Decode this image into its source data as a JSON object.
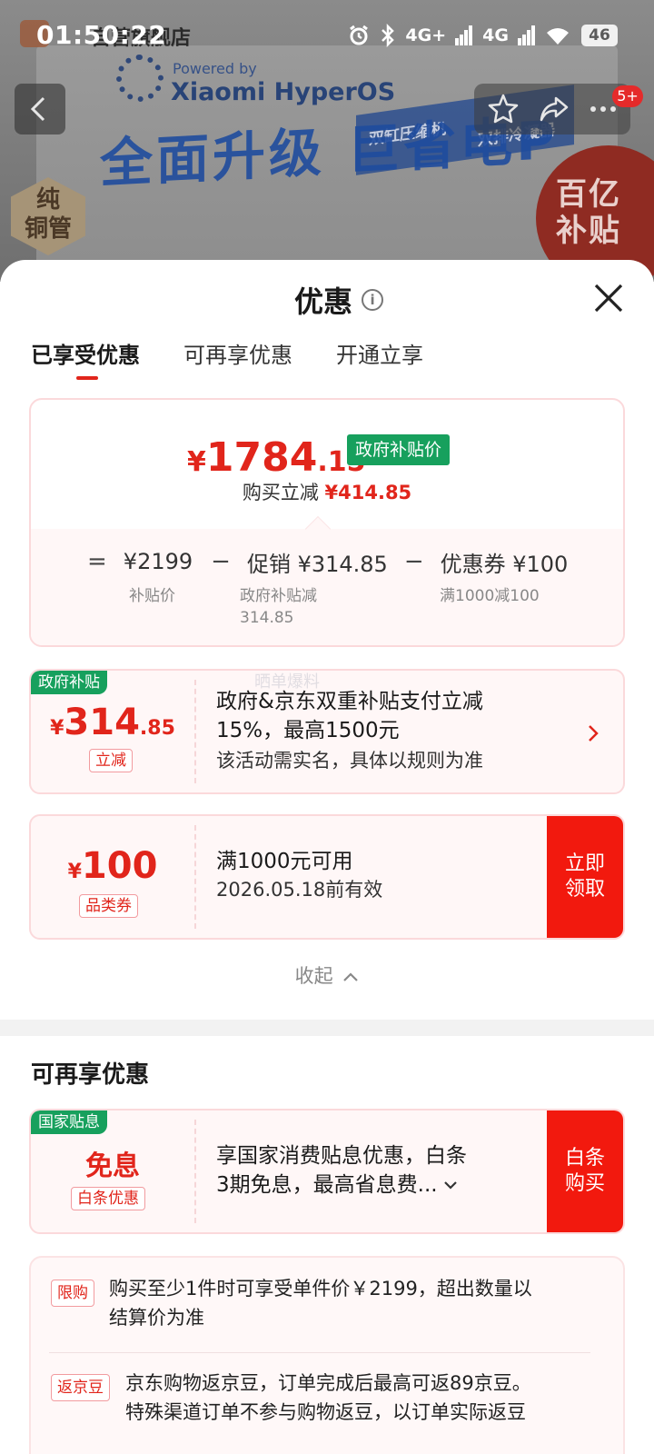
{
  "status_bar": {
    "time": "01:50:22",
    "network_left": "4G+",
    "network_right": "4G",
    "battery": "46"
  },
  "background_page": {
    "store_name": "自营旗舰店",
    "banner_powered": "Powered by",
    "banner_brand": "Xiaomi HyperOS",
    "banner_tag_1": "双缸压缩机",
    "banner_tag_2": "双排冷凝器",
    "banner_headline": "全面升级 巨省电P",
    "badge_line_1": "纯",
    "badge_line_2": "铜管",
    "subsidy_badge_1": "百亿",
    "subsidy_badge_2": "补贴",
    "cart_badge": "5+"
  },
  "sheet": {
    "title": "优惠",
    "tabs": [
      {
        "label": "已享受优惠",
        "active": true
      },
      {
        "label": "可再享优惠",
        "active": false
      },
      {
        "label": "开通立享",
        "active": false
      }
    ],
    "price_card": {
      "currency": "¥",
      "price_int": "1784",
      "price_dec": ".15",
      "price_tag": "政府补贴价",
      "reduce_label": "购买立减",
      "reduce_amount": "¥414.85",
      "calc": {
        "eq": "=",
        "base": "¥2199",
        "base_sub": "补贴价",
        "minus": "−",
        "promo": "促销 ¥314.85",
        "promo_sub_1": "政府补贴减",
        "promo_sub_2": "314.85",
        "coupon": "优惠券 ¥100",
        "coupon_sub": "满1000减100"
      }
    },
    "gov_subsidy": {
      "corner_tag": "政府补贴",
      "currency": "¥",
      "amount_int": "314",
      "amount_dec": ".85",
      "mini_tag": "立减",
      "text_line_1": "政府&京东双重补贴支付立减",
      "text_line_2": "15%，最高1500元",
      "sub_text": "该活动需实名，具体以规则为准",
      "watermark": "晒单爆料"
    },
    "category_coupon": {
      "currency": "¥",
      "amount": "100",
      "mini_tag": "品类券",
      "text_line": "满1000元可用",
      "validity": "2026.05.18前有效",
      "button": "立即领取"
    },
    "collapse_label": "收起",
    "more_section_title": "可再享优惠",
    "interest_free": {
      "corner_tag": "国家贴息",
      "title": "免息",
      "mini_tag": "白条优惠",
      "text_line_1": "享国家消费贴息优惠，白条",
      "text_line_2": "3期免息，最高省息费...",
      "button": "白条购买"
    },
    "rules": [
      {
        "tag": "限购",
        "line_1": "购买至少1件时可享受单件价￥2199，超出数量以",
        "line_2": "结算价为准"
      },
      {
        "tag": "返京豆",
        "line_1": "京东购物返京豆，订单完成后最高可返89京豆。",
        "line_2": "特殊渠道订单不参与购物返豆，以订单实际返豆"
      }
    ]
  },
  "colors": {
    "accent_red": "#e1251b",
    "button_red": "#f2190e",
    "gov_green": "#17a05d"
  }
}
